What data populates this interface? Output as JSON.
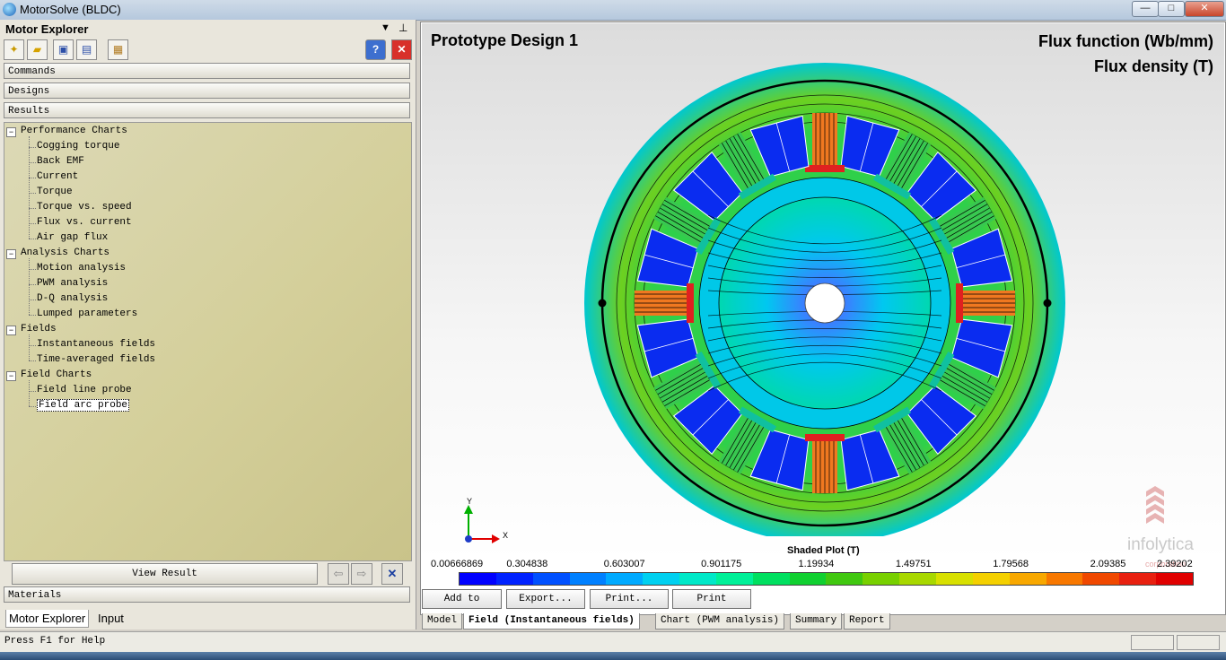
{
  "window": {
    "title": "MotorSolve (BLDC)",
    "controls": {
      "minimize": "—",
      "maximize": "□",
      "close": "✕"
    }
  },
  "explorer": {
    "title": "Motor Explorer",
    "menu_glyph": "▼",
    "pin_glyph": "⊥",
    "toolbar": [
      {
        "icon": "new-file-icon",
        "glyph": "✦"
      },
      {
        "icon": "open-folder-icon",
        "glyph": "▰"
      },
      {
        "icon": "save-icon",
        "glyph": "▣"
      },
      {
        "icon": "save-as-icon",
        "glyph": "▤"
      },
      {
        "icon": "properties-icon",
        "glyph": "▦"
      }
    ],
    "help_glyph": "?",
    "close_glyph": "✕",
    "sections": {
      "commands": "Commands",
      "designs": "Designs",
      "results": "Results",
      "materials": "Materials"
    },
    "tree": {
      "groups": [
        {
          "label": "Performance Charts",
          "items": [
            "Cogging torque",
            "Back EMF",
            "Current",
            "Torque",
            "Torque vs. speed",
            "Flux vs. current",
            "Air gap flux"
          ]
        },
        {
          "label": "Analysis Charts",
          "items": [
            "Motion analysis",
            "PWM analysis",
            "D-Q analysis",
            "Lumped parameters"
          ]
        },
        {
          "label": "Fields",
          "items": [
            "Instantaneous fields",
            "Time-averaged fields"
          ]
        },
        {
          "label": "Field Charts",
          "items": [
            "Field line probe",
            "Field arc probe"
          ]
        }
      ],
      "selected": "Field arc probe"
    },
    "view_result": "View Result",
    "bottom_tabs": [
      "Motor Explorer",
      "Input"
    ]
  },
  "viewer": {
    "design_title": "Prototype Design 1",
    "flux_function": "Flux function (Wb/mm)",
    "flux_density": "Flux density (T)",
    "axis_y": "Y",
    "axis_x": "X",
    "logo_text": "infolytica",
    "logo_sub": "corporation",
    "legend": {
      "title": "Shaded Plot (T)",
      "ticks": [
        "0.00666869",
        "0.304838",
        "0.603007",
        "0.901175",
        "1.19934",
        "1.49751",
        "1.79568",
        "2.09385",
        "2.39202"
      ],
      "colors": [
        "#0000ff",
        "#0022ff",
        "#0050ff",
        "#0080ff",
        "#00aaff",
        "#00d0f0",
        "#00e8c8",
        "#00f098",
        "#00e060",
        "#10d030",
        "#40c810",
        "#78d000",
        "#a8d800",
        "#d8e000",
        "#f4d000",
        "#f8a800",
        "#f87800",
        "#f04800",
        "#e82010",
        "#e00000"
      ]
    },
    "actions": [
      "Add to",
      "Export...",
      "Print...",
      "Print"
    ],
    "tabs": [
      "Model",
      "Field (Instantaneous fields)",
      "Chart (PWM analysis)",
      "Summary",
      "Report"
    ],
    "active_tab": "Field (Instantaneous fields)"
  },
  "status": {
    "text": "Press F1 for Help"
  }
}
